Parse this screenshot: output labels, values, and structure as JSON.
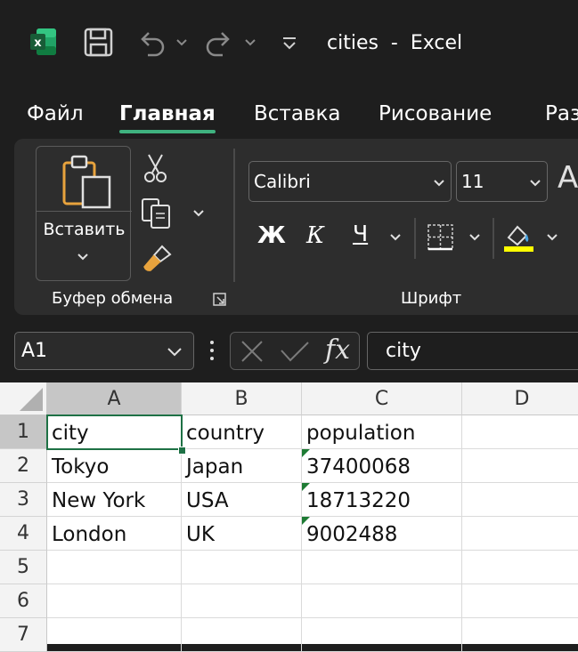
{
  "window": {
    "title": "cities  -  Excel"
  },
  "tabs": [
    "Файл",
    "Главная",
    "Вставка",
    "Рисование",
    "Раз"
  ],
  "ribbon": {
    "paste_label": "Вставить",
    "clipboard_group": "Буфер обмена",
    "font_name": "Calibri",
    "font_size": "11",
    "bold": "Ж",
    "italic": "К",
    "underline": "Ч",
    "font_group": "Шрифт",
    "font_grow_glyph": "A"
  },
  "formula_bar": {
    "name_box": "A1",
    "fx": "fx",
    "content": "city"
  },
  "sheet": {
    "columns": [
      "A",
      "B",
      "C",
      "D"
    ],
    "rows": [
      "1",
      "2",
      "3",
      "4",
      "5",
      "6",
      "7"
    ],
    "cells": [
      [
        "city",
        "country",
        "population"
      ],
      [
        "Tokyo",
        "Japan",
        "37400068"
      ],
      [
        "New York",
        "USA",
        "18713220"
      ],
      [
        "London",
        "UK",
        "9002488"
      ]
    ]
  },
  "colors": {
    "accent": "#3fb27f",
    "excel_green": "#1d6f42",
    "highlight_yellow": "#ffff00"
  }
}
